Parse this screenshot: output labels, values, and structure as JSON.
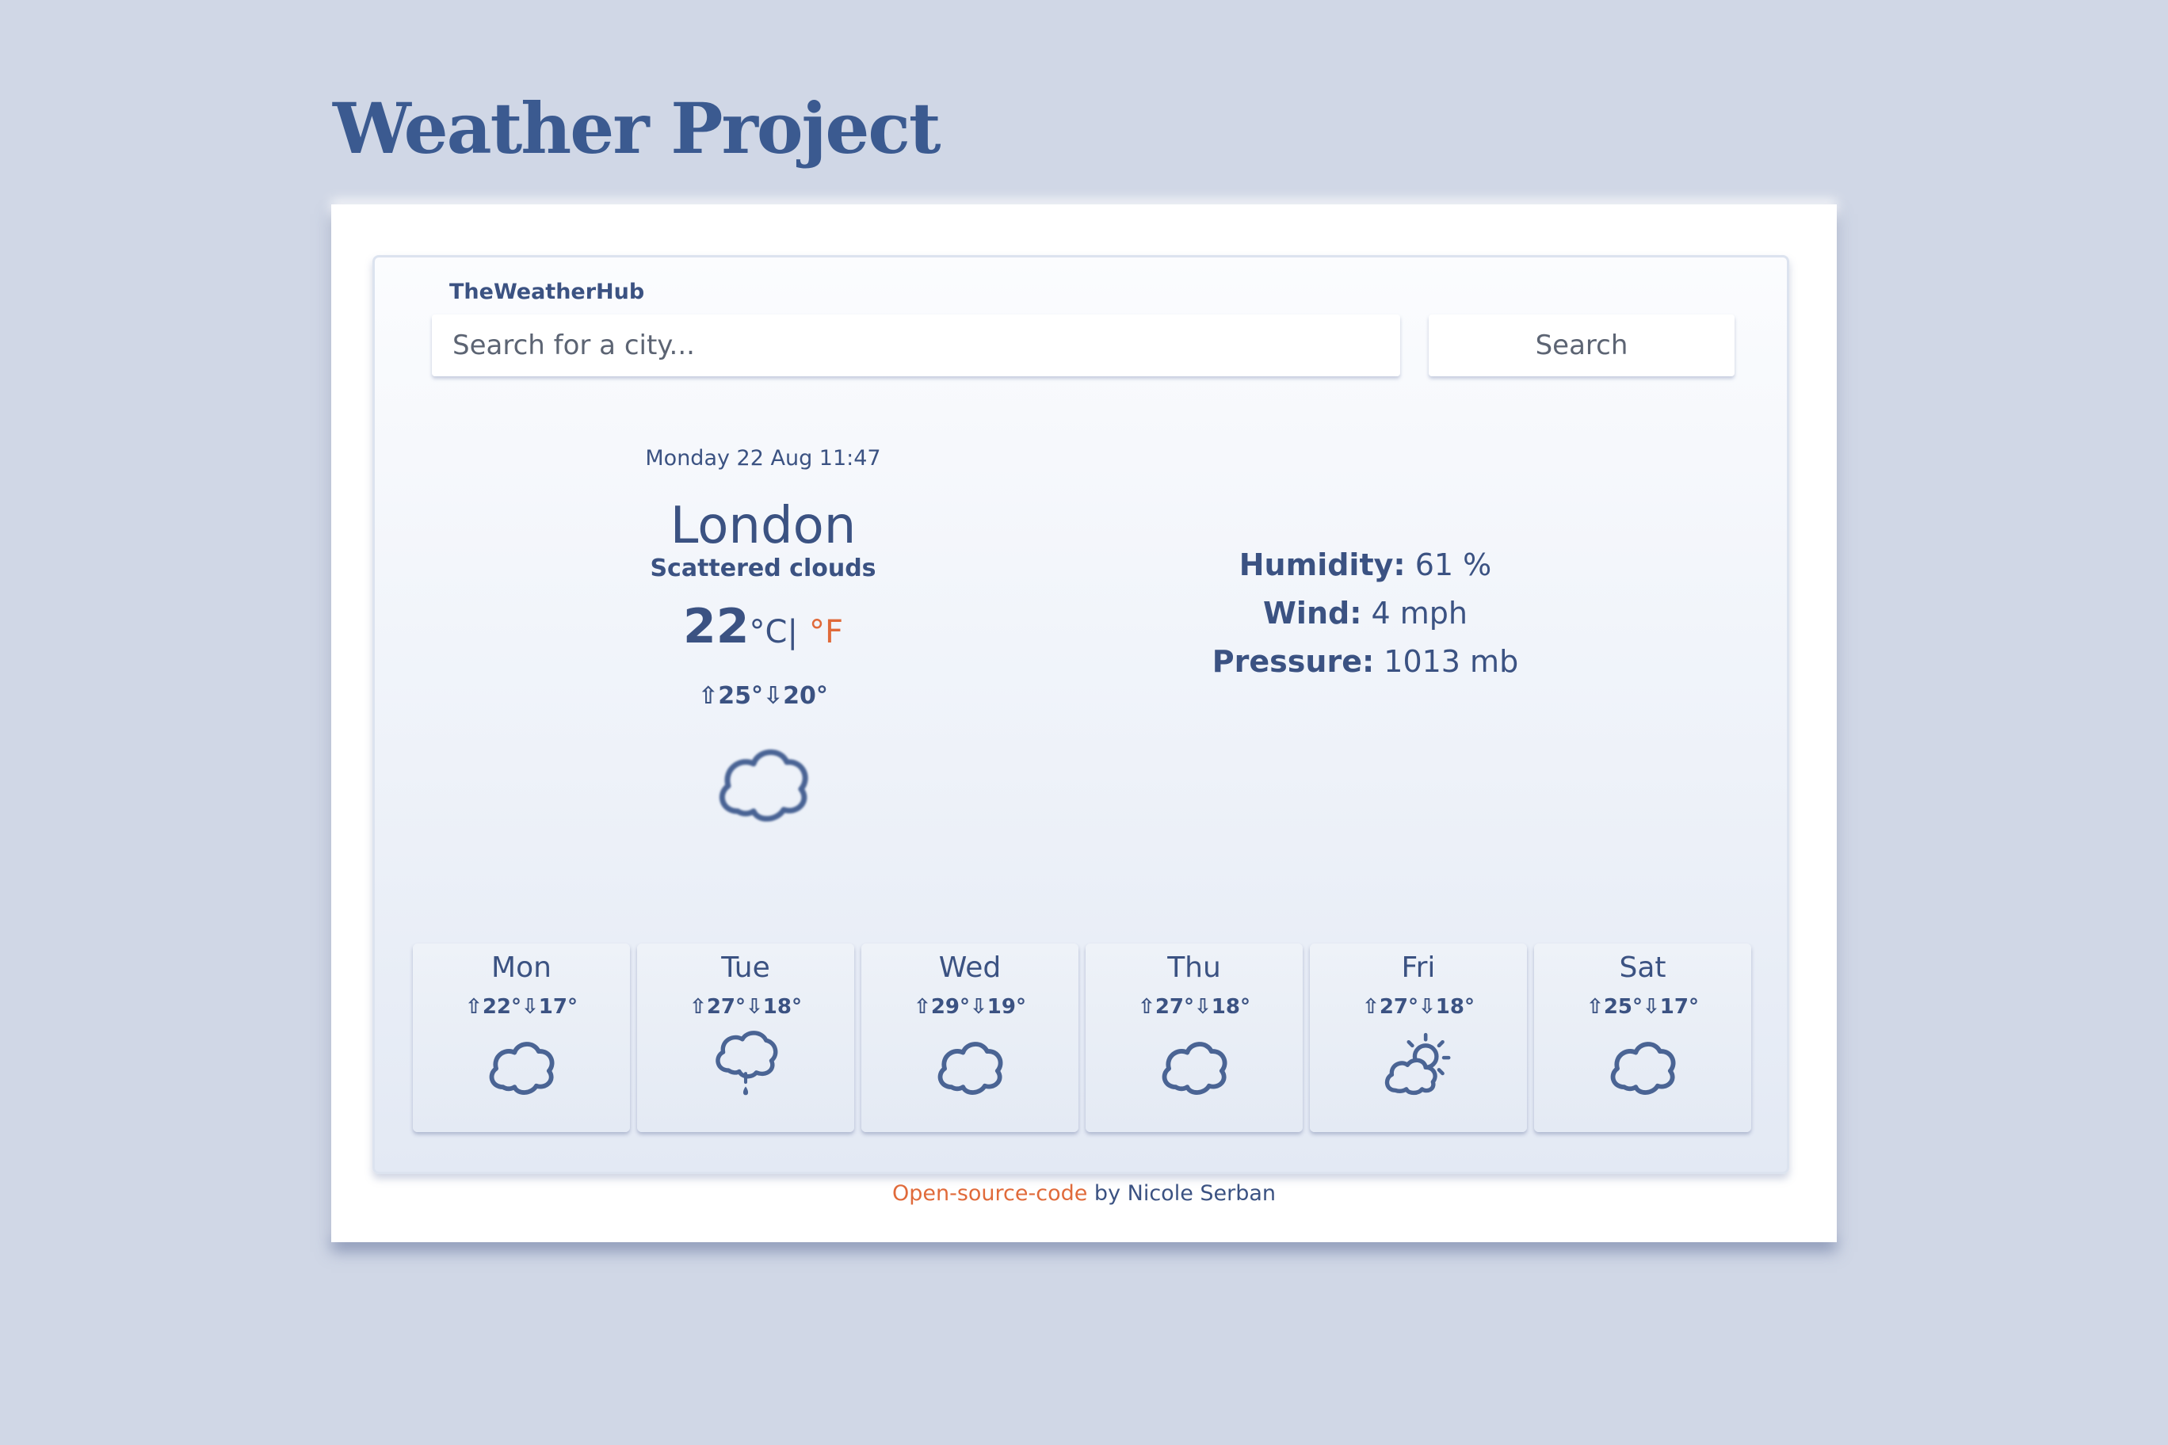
{
  "page": {
    "title": "Weather Project"
  },
  "app": {
    "brand": "TheWeatherHub",
    "search": {
      "placeholder": "Search for a city...",
      "value": "",
      "button_label": "Search"
    },
    "current": {
      "datetime": "Monday 22 Aug 11:47",
      "city": "London",
      "description": "Scattered clouds",
      "temperature": "22",
      "unit_celsius": "°C",
      "unit_separator": "|",
      "unit_fahrenheit": "°F",
      "hilo": "⇧25°⇩20°",
      "icon": "cloud-icon"
    },
    "details": {
      "humidity_label": "Humidity:",
      "humidity_value": "61 %",
      "wind_label": "Wind:",
      "wind_value": "4 mph",
      "pressure_label": "Pressure:",
      "pressure_value": "1013 mb"
    },
    "forecast": [
      {
        "day": "Mon",
        "hilo": "⇧22°⇩17°",
        "icon": "cloud-icon"
      },
      {
        "day": "Tue",
        "hilo": "⇧27°⇩18°",
        "icon": "light-rain-icon"
      },
      {
        "day": "Wed",
        "hilo": "⇧29°⇩19°",
        "icon": "cloud-icon"
      },
      {
        "day": "Thu",
        "hilo": "⇧27°⇩18°",
        "icon": "cloud-icon"
      },
      {
        "day": "Fri",
        "hilo": "⇧27°⇩18°",
        "icon": "partly-sunny-icon"
      },
      {
        "day": "Sat",
        "hilo": "⇧25°⇩17°",
        "icon": "cloud-icon"
      }
    ]
  },
  "footer": {
    "link_text": "Open-source-code",
    "author_text": " by Nicole Serban"
  },
  "colors": {
    "background": "#d0d7e6",
    "primary_text": "#3b5282",
    "accent": "#e06a3a",
    "icon_stroke": "#4a6494"
  }
}
